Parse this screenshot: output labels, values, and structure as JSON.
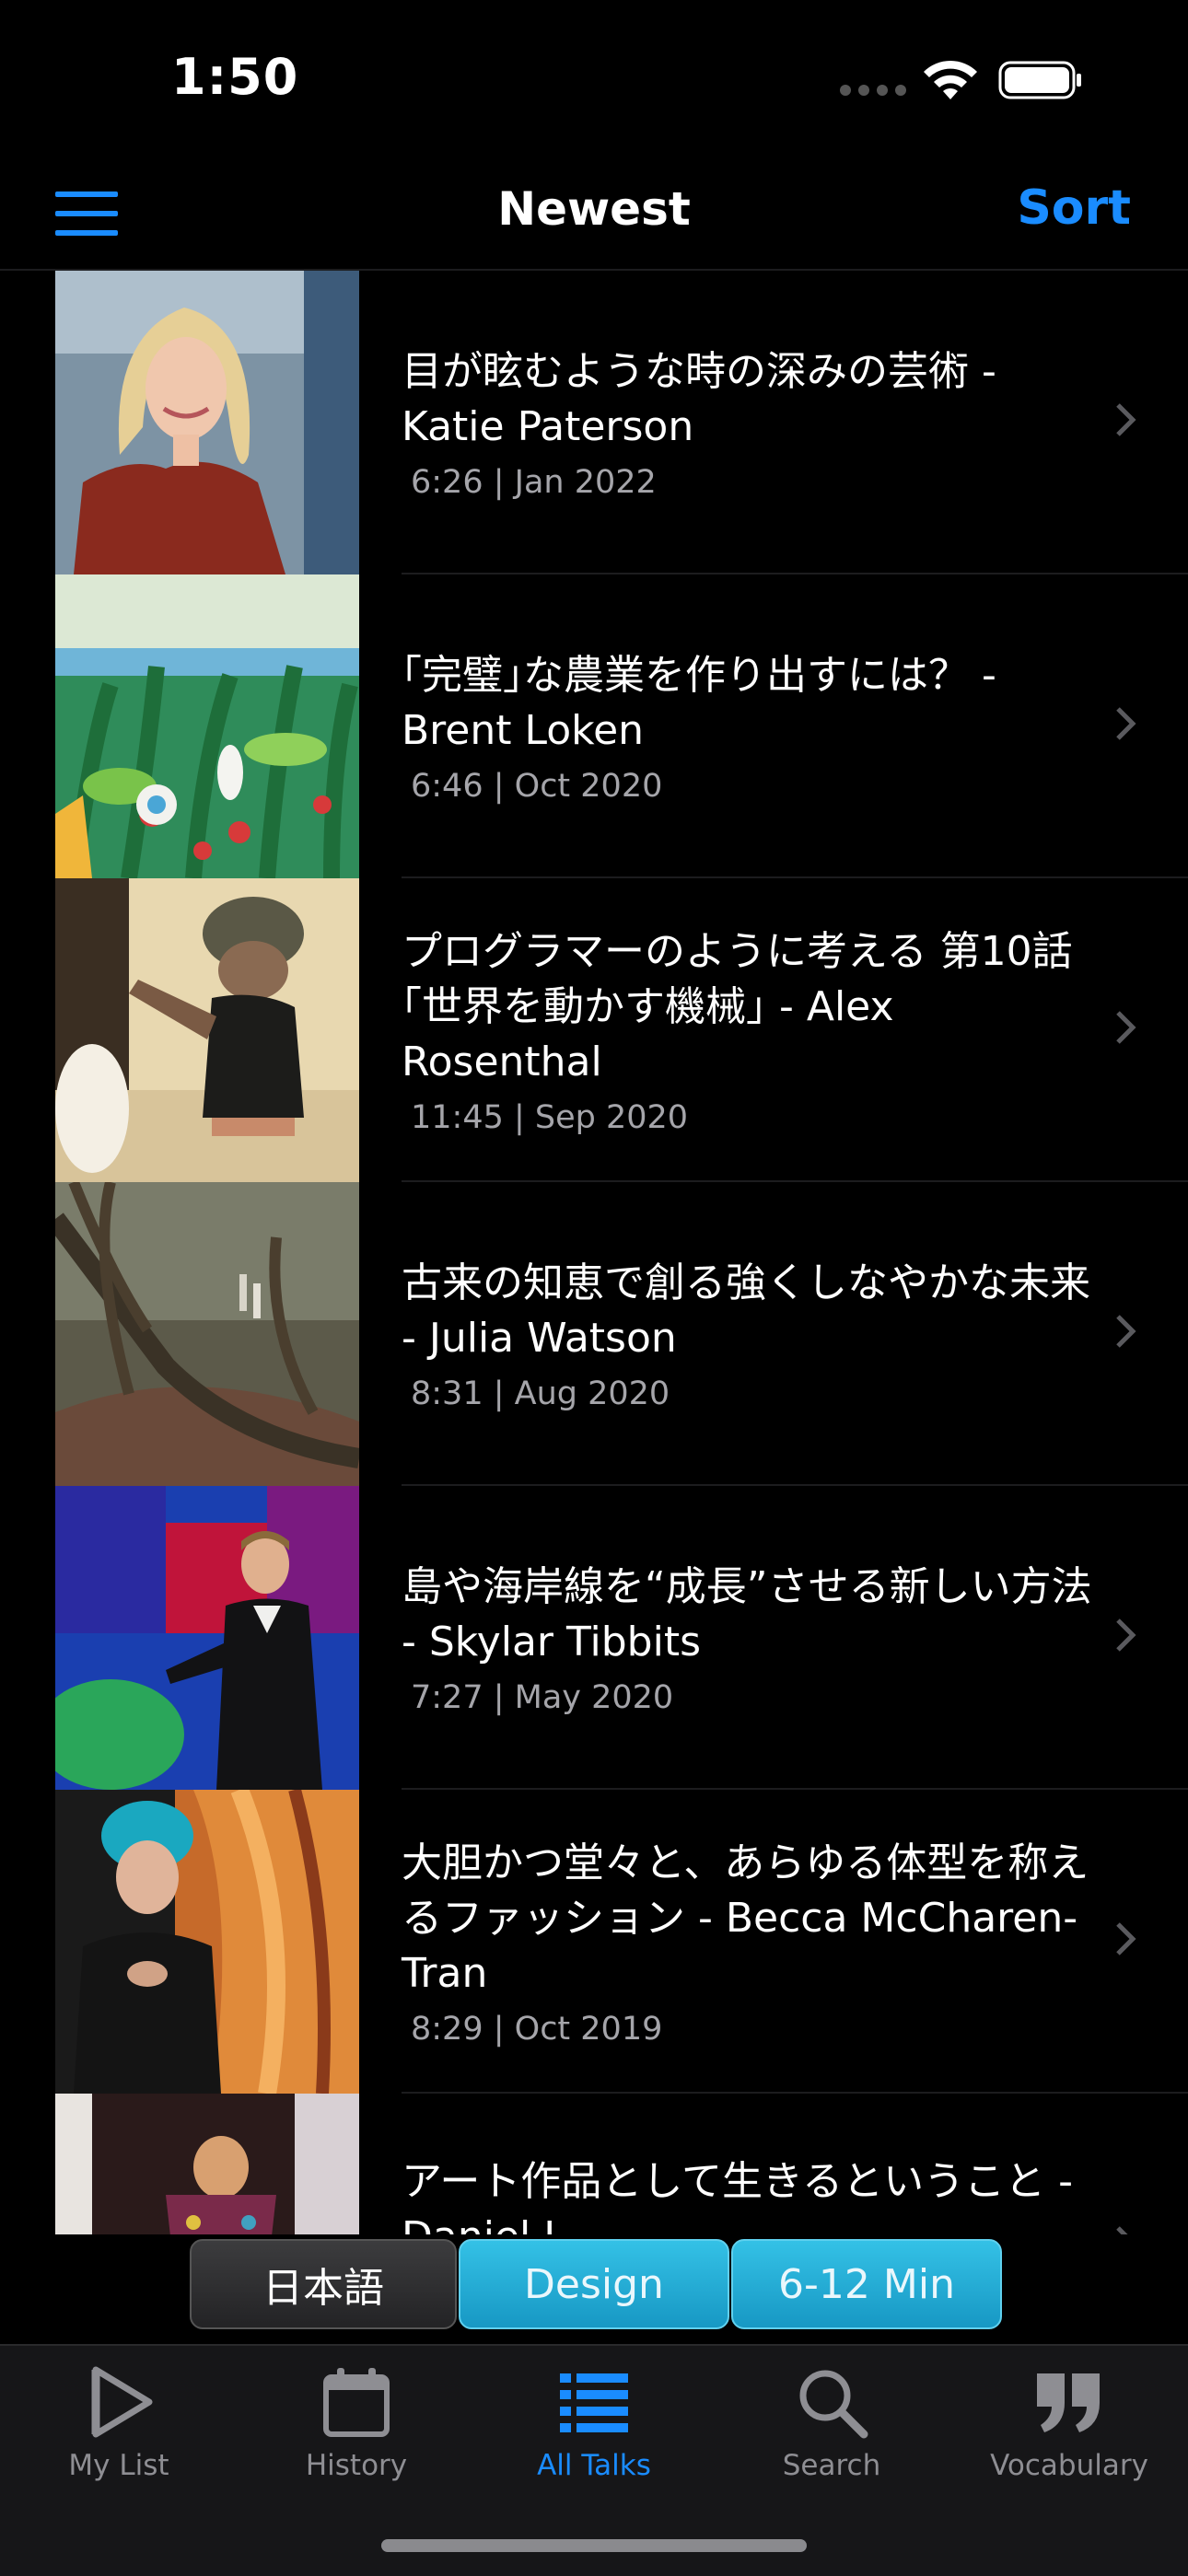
{
  "status_bar": {
    "time": "1:50"
  },
  "nav": {
    "title": "Newest",
    "sort_label": "Sort"
  },
  "talks": [
    {
      "title": "目が眩むような時の深みの芸術 - Katie Paterson",
      "meta": "6:26 | Jan 2022"
    },
    {
      "title": "｢完璧｣な農業を作り出すには？ - Brent Loken",
      "meta": "6:46 | Oct 2020"
    },
    {
      "title": "プログラマーのように考える 第10話 ｢世界を動かす機械｣ - Alex Rosenthal",
      "meta": "11:45 | Sep 2020"
    },
    {
      "title": "古来の知恵で創る強くしなやかな未来 - Julia Watson",
      "meta": "8:31 | Aug 2020"
    },
    {
      "title": "島や海岸線を“成長”させる新しい方法 - Skylar Tibbits",
      "meta": "7:27 | May 2020"
    },
    {
      "title": "大胆かつ堂々と、あらゆる体型を称えるファッション - Becca McCharen-Tran",
      "meta": "8:29 | Oct 2019"
    },
    {
      "title": "アート作品として生きるということ - Daniel L...",
      "meta": ""
    }
  ],
  "filters": [
    {
      "label": "日本語"
    },
    {
      "label": "Design"
    },
    {
      "label": "6-12 Min"
    }
  ],
  "tabs": [
    {
      "label": "My List",
      "icon": "play-icon"
    },
    {
      "label": "History",
      "icon": "calendar-icon"
    },
    {
      "label": "All Talks",
      "icon": "list-icon"
    },
    {
      "label": "Search",
      "icon": "search-icon"
    },
    {
      "label": "Vocabulary",
      "icon": "quote-icon"
    }
  ],
  "colors": {
    "accent": "#1a8cff",
    "chip_active": "#1fa8d6",
    "background": "#000000"
  }
}
